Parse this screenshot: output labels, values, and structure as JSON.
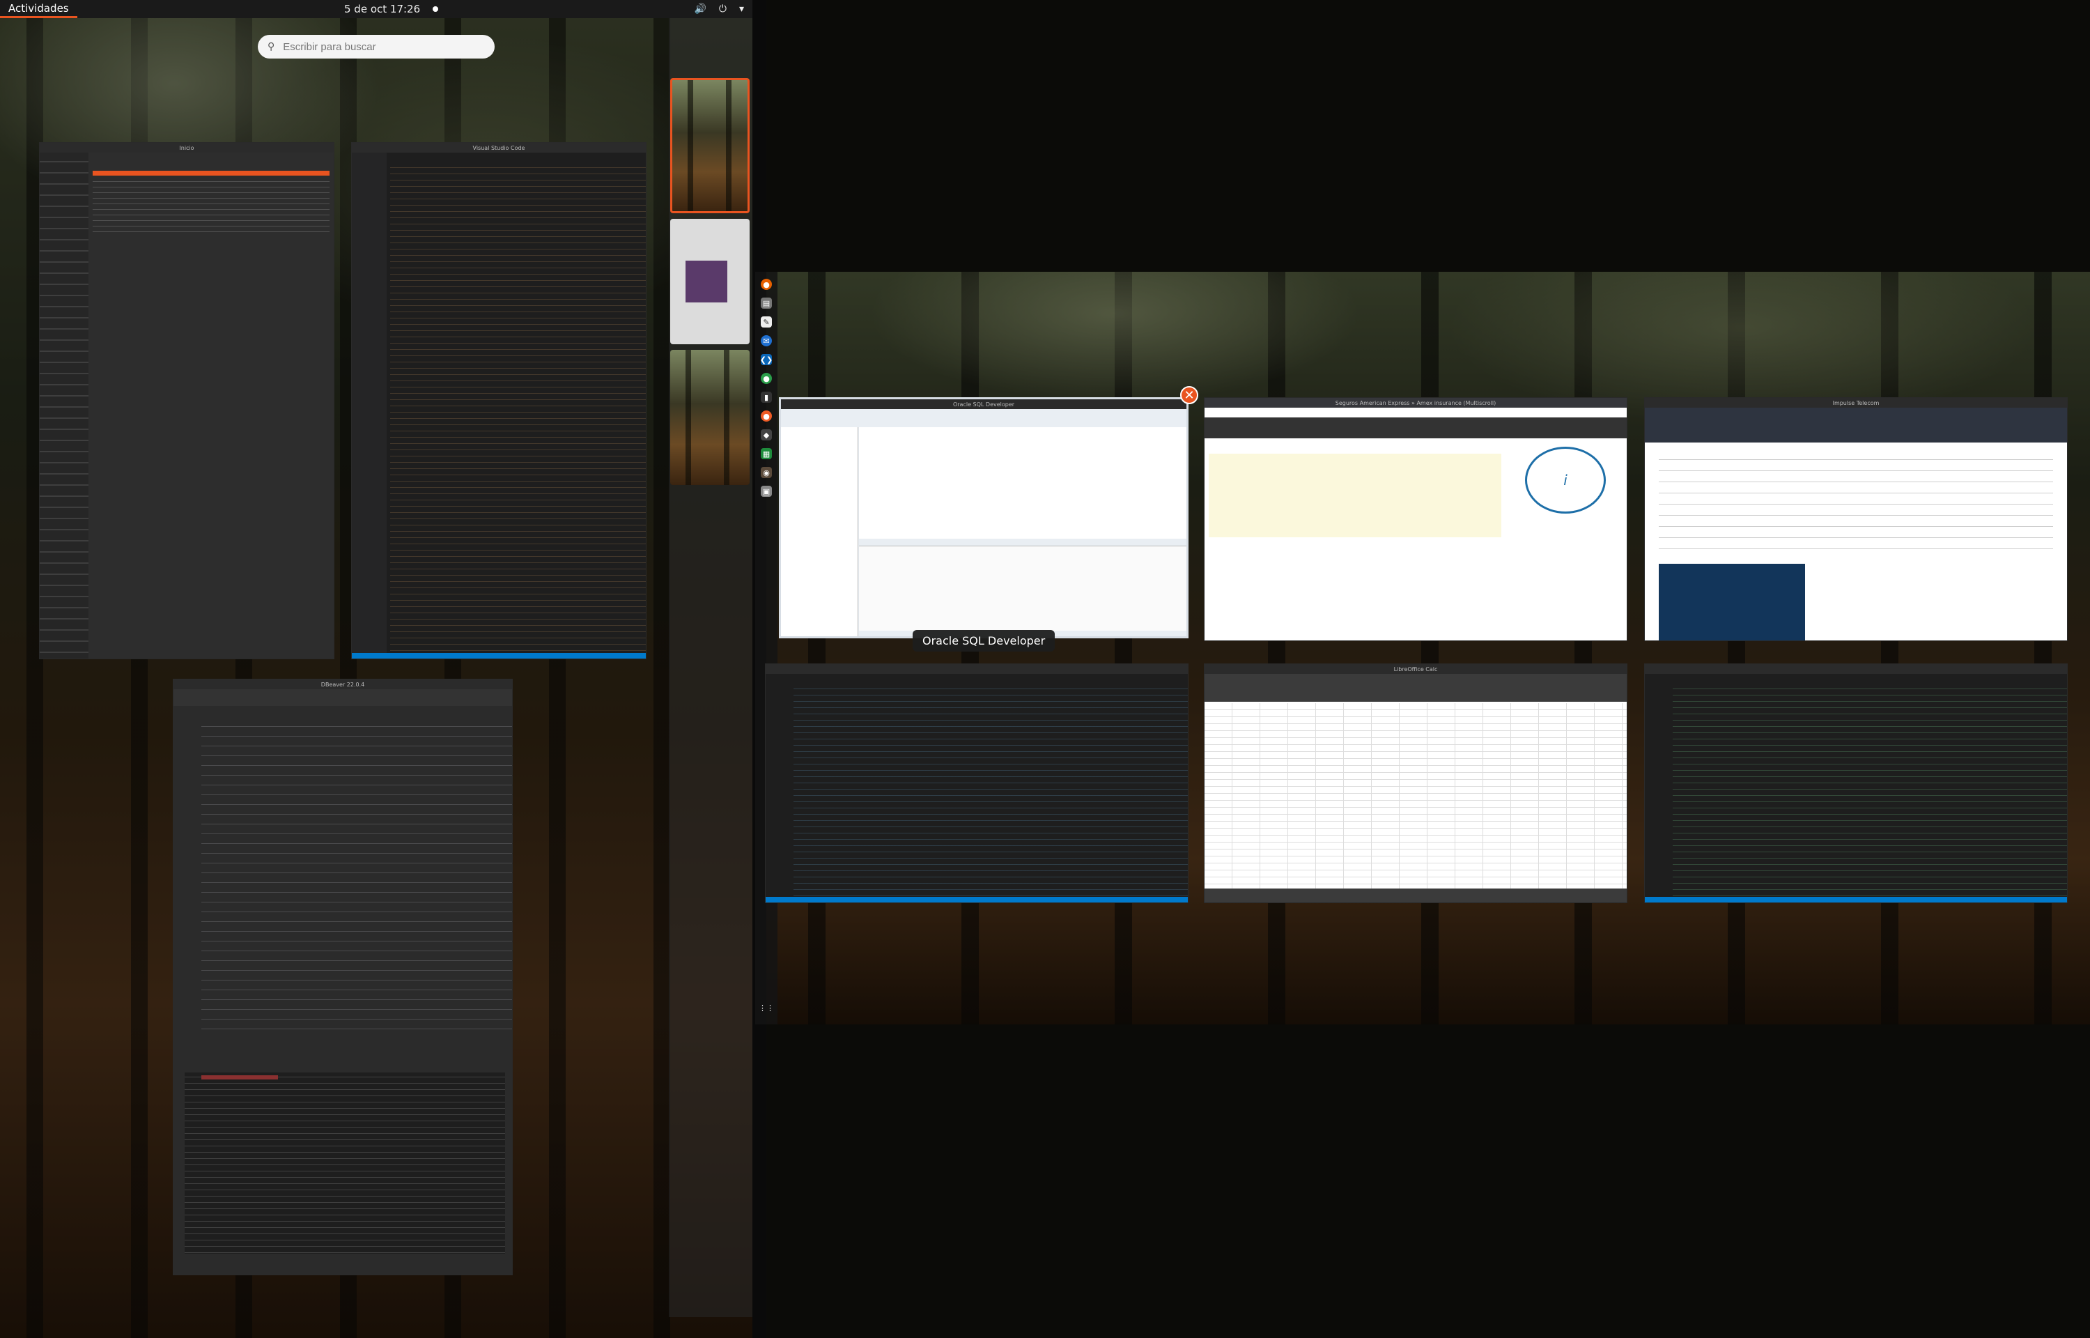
{
  "topbar": {
    "activities": "Actividades",
    "datetime": "5 de oct  17:26",
    "system_icons": [
      "volume-icon",
      "power-icon",
      "menu-arrow-icon"
    ]
  },
  "search": {
    "placeholder": "Escribir para buscar"
  },
  "tooltip": "Oracle SQL Developer",
  "windows": {
    "files": {
      "title": "Inicio"
    },
    "vscode": {
      "title": "Visual Studio Code"
    },
    "dbeaver": {
      "title": "DBeaver 22.0.4"
    },
    "sqldev": {
      "title": "Oracle SQL Developer"
    },
    "chrome": {
      "title": "Seguros American Express » Amex insurance (Multiscroll)"
    },
    "mail": {
      "title": "Impulse Telecom"
    },
    "calc": {
      "title": "LibreOffice Calc"
    }
  },
  "colors": {
    "accent": "#e95420",
    "topbar": "#1a1a1a"
  }
}
